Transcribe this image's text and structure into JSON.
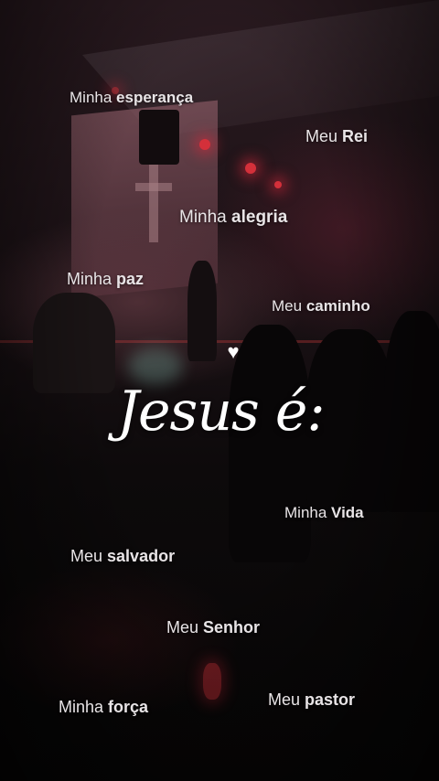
{
  "title": "Jesus é:",
  "heart_icon": "heart-icon",
  "phrases": [
    {
      "light": "Minha",
      "bold": "esperança"
    },
    {
      "light": "Meu",
      "bold": "Rei"
    },
    {
      "light": "Minha",
      "bold": "alegria"
    },
    {
      "light": "Minha",
      "bold": "paz"
    },
    {
      "light": "Meu",
      "bold": "caminho"
    },
    {
      "light": "Minha",
      "bold": "Vida"
    },
    {
      "light": "Meu",
      "bold": "salvador"
    },
    {
      "light": "Meu",
      "bold": "Senhor"
    },
    {
      "light": "Minha",
      "bold": "força"
    },
    {
      "light": "Meu",
      "bold": "pastor"
    }
  ]
}
